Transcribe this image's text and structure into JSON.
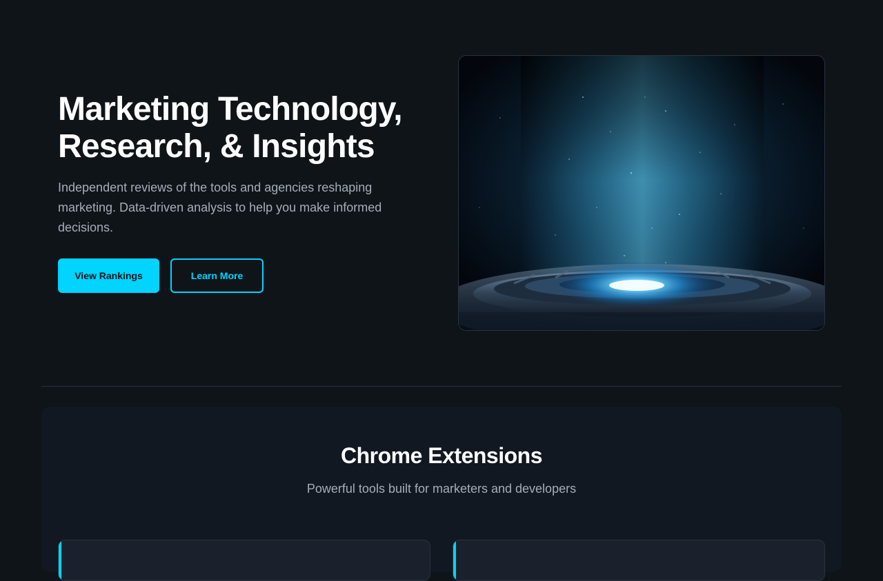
{
  "hero": {
    "title_line1": "Marketing Technology,",
    "title_line2": "Research, & Insights",
    "subtitle": "Independent reviews of the tools and agencies reshaping marketing. Data-driven analysis to help you make informed decisions.",
    "primary_button": "View Rankings",
    "secondary_button": "Learn More",
    "image_alt": "Glowing blue energy beam rising from a circular metallic platform"
  },
  "extensions": {
    "title": "Chrome Extensions",
    "subtitle": "Powerful tools built for marketers and developers"
  },
  "colors": {
    "background": "#0f1419",
    "accent": "#00d4ff",
    "text_primary": "#ffffff",
    "text_secondary": "#a6adb6"
  }
}
